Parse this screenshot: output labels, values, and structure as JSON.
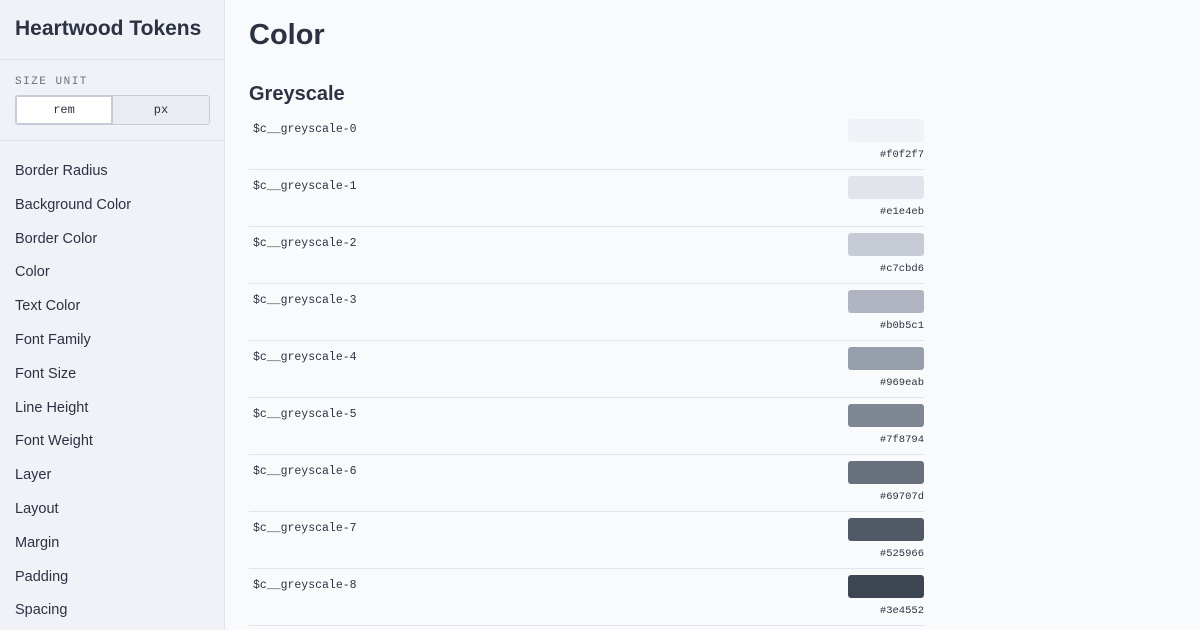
{
  "brand": "Heartwood Tokens",
  "size_unit": {
    "label": "SIZE UNIT",
    "options": [
      "rem",
      "px"
    ],
    "selected": "rem"
  },
  "nav": [
    "Border Radius",
    "Background Color",
    "Border Color",
    "Color",
    "Text Color",
    "Font Family",
    "Font Size",
    "Line Height",
    "Font Weight",
    "Layer",
    "Layout",
    "Margin",
    "Padding",
    "Spacing"
  ],
  "page_title": "Color",
  "section_title": "Greyscale",
  "tokens": [
    {
      "name": "$c__greyscale-0",
      "hex": "#f0f2f7",
      "color": "#f0f2f7"
    },
    {
      "name": "$c__greyscale-1",
      "hex": "#e1e4eb",
      "color": "#e1e4eb"
    },
    {
      "name": "$c__greyscale-2",
      "hex": "#c7cbd6",
      "color": "#c7cbd6"
    },
    {
      "name": "$c__greyscale-3",
      "hex": "#b0b5c1",
      "color": "#b0b5c1"
    },
    {
      "name": "$c__greyscale-4",
      "hex": "#969eab",
      "color": "#969eab"
    },
    {
      "name": "$c__greyscale-5",
      "hex": "#7f8794",
      "color": "#7f8794"
    },
    {
      "name": "$c__greyscale-6",
      "hex": "#69707d",
      "color": "#69707d"
    },
    {
      "name": "$c__greyscale-7",
      "hex": "#525966",
      "color": "#525966"
    },
    {
      "name": "$c__greyscale-8",
      "hex": "#3e4552",
      "color": "#3e4552"
    }
  ]
}
